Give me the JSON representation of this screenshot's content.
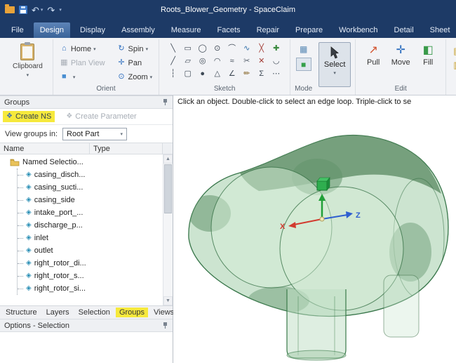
{
  "window": {
    "title": "Roots_Blower_Geometry - SpaceClaim"
  },
  "icons": {
    "undo": "↶",
    "redo": "↷",
    "dropdown": "▾",
    "create_ns": "❖",
    "create_param": "❖",
    "scroll_up": "▲",
    "scroll_down": "▼"
  },
  "tabs": [
    {
      "label": "File"
    },
    {
      "label": "Design",
      "active": true
    },
    {
      "label": "Display"
    },
    {
      "label": "Assembly"
    },
    {
      "label": "Measure"
    },
    {
      "label": "Facets"
    },
    {
      "label": "Repair"
    },
    {
      "label": "Prepare"
    },
    {
      "label": "Workbench"
    },
    {
      "label": "Detail"
    },
    {
      "label": "Sheet"
    }
  ],
  "ribbon": {
    "clipboard": {
      "label": "Clipboard",
      "caret": "▾"
    },
    "orient": {
      "label": "Orient",
      "items": [
        {
          "icon": "⌂",
          "color": "#2f6fbf",
          "label": "Home",
          "caret": "▾"
        },
        {
          "icon": "↻",
          "color": "#2f6fbf",
          "label": "Spin",
          "caret": "▾"
        },
        {
          "icon": "▦",
          "color": "#a8aeb6",
          "label": "Plan View",
          "caret": "",
          "disabled": true
        },
        {
          "icon": "✛",
          "color": "#2f6fbf",
          "label": "Pan",
          "caret": ""
        },
        {
          "icon": "■",
          "color": "#4a8fd1",
          "label": "",
          "caret": "▾"
        },
        {
          "icon": "⊙",
          "color": "#2f6fbf",
          "label": "Zoom",
          "caret": "▾"
        }
      ]
    },
    "sketch": {
      "label": "Sketch",
      "tools": [
        {
          "glyph": "╲",
          "color": "#3f4a56"
        },
        {
          "glyph": "▭",
          "color": "#3f4a56"
        },
        {
          "glyph": "◯",
          "color": "#3f4a56"
        },
        {
          "glyph": "⊙",
          "color": "#3f4a56"
        },
        {
          "glyph": "⌒",
          "color": "#3f4a56"
        },
        {
          "glyph": "∿",
          "color": "#2f6fa8"
        },
        {
          "glyph": "╳",
          "color": "#a23b35"
        },
        {
          "glyph": "✚",
          "color": "#3a8a3f"
        },
        {
          "glyph": "╱",
          "color": "#3f4a56"
        },
        {
          "glyph": "▱",
          "color": "#3f4a56"
        },
        {
          "glyph": "◎",
          "color": "#3f4a56"
        },
        {
          "glyph": "◠",
          "color": "#3f4a56"
        },
        {
          "glyph": "≈",
          "color": "#3f4a56"
        },
        {
          "glyph": "✂",
          "color": "#5a6470"
        },
        {
          "glyph": "✕",
          "color": "#a23b35"
        },
        {
          "glyph": "◡",
          "color": "#3f4a56"
        },
        {
          "glyph": "┆",
          "color": "#3f4a56"
        },
        {
          "glyph": "▢",
          "color": "#3f4a56"
        },
        {
          "glyph": "●",
          "color": "#3f4a56"
        },
        {
          "glyph": "△",
          "color": "#3f4a56"
        },
        {
          "glyph": "∠",
          "color": "#3f4a56"
        },
        {
          "glyph": "✏",
          "color": "#8a6a2f"
        },
        {
          "glyph": "Σ",
          "color": "#3f4a56"
        },
        {
          "glyph": "⋯",
          "color": "#3f4a56"
        }
      ]
    },
    "mode": {
      "label": "Mode",
      "icons": [
        {
          "glyph": "▦",
          "color": "#5a8ab5"
        },
        {
          "glyph": "■",
          "color": "#35a04a",
          "pressed": true
        }
      ]
    },
    "select": {
      "label": "Select",
      "caret": "▾"
    },
    "edit": {
      "label": "Edit",
      "items": [
        {
          "icon": "↗",
          "color": "#d2522e",
          "label": "Pull"
        },
        {
          "icon": "✛",
          "color": "#2f6fbf",
          "label": "Move"
        },
        {
          "icon": "◧",
          "color": "#3a9a4a",
          "label": "Fill"
        }
      ]
    },
    "extra": [
      {
        "glyph": "▤",
        "color": "#c9a22f"
      },
      {
        "glyph": "▥",
        "color": "#c9a22f"
      }
    ]
  },
  "groups_panel": {
    "header": "Groups",
    "create_ns": "Create NS",
    "create_parameter": "Create Parameter",
    "view_groups_label": "View groups in:",
    "view_groups_value": "Root Part",
    "col_name": "Name",
    "col_type": "Type",
    "root_folder": "Named Selectio...",
    "item_icon": "◈",
    "items": [
      "casing_disch...",
      "casing_sucti...",
      "casing_side",
      "intake_port_...",
      "discharge_p...",
      "inlet",
      "outlet",
      "right_rotor_di...",
      "right_rotor_s...",
      "right_rotor_si..."
    ],
    "tabs": [
      {
        "label": "Structure"
      },
      {
        "label": "Layers"
      },
      {
        "label": "Selection"
      },
      {
        "label": "Groups",
        "highlight": true
      },
      {
        "label": "Views"
      }
    ]
  },
  "options_panel": {
    "header": "Options - Selection"
  },
  "viewport": {
    "status": "Click an object. Double-click to select an edge loop. Triple-click to se",
    "axes": {
      "x": "X",
      "z": "Z"
    }
  }
}
